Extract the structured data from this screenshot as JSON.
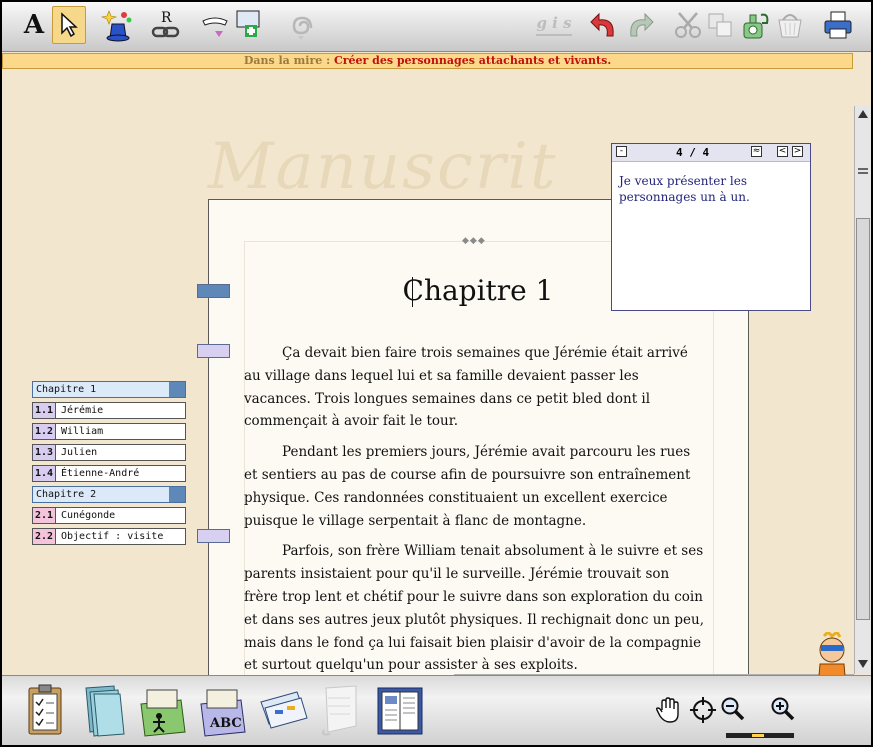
{
  "toolbar": {
    "text_tool_label": "A",
    "reference_tool_label": "R",
    "gis_label": "g i s"
  },
  "mire": {
    "label": "Dans la mire :",
    "goal": "Créer des personnages attachants et vivants."
  },
  "watermark": "Manuscrit",
  "manuscript": {
    "chapter_title": "Chapitre 1",
    "paragraphs": [
      "Ça devait bien faire trois semaines que Jérémie était arrivé au village dans lequel lui et sa famille devaient passer les vacances. Trois longues semaines dans ce petit bled dont il commençait à avoir fait le tour.",
      "Pendant les premiers jours, Jérémie avait parcouru les rues et sentiers au pas de course afin de poursuivre son entraînement physique. Ces randonnées constituaient un excellent exercice puisque le village serpentait à flanc de montagne.",
      "Parfois, son frère William tenait absolument à le suivre et ses parents insistaient pour qu'il le surveille. Jérémie trouvait son frère trop lent et chétif pour le suivre dans son exploration du coin et dans ses autres jeux plutôt physiques. Il rechignait donc un peu, mais dans le fond ça lui faisait bien plaisir d'avoir de la compagnie et surtout quelqu'un pour assister à ses exploits."
    ]
  },
  "note": {
    "minus": "-",
    "counter": "4 / 4",
    "wave": "≈",
    "prev": "<",
    "next": ">",
    "text": "Je veux présenter les personnages un à un."
  },
  "outline": {
    "chapters": [
      {
        "title": "Chapitre 1",
        "scenes": [
          {
            "num": "1.1",
            "name": "Jérémie"
          },
          {
            "num": "1.2",
            "name": "William"
          },
          {
            "num": "1.3",
            "name": "Julien"
          },
          {
            "num": "1.4",
            "name": "Étienne-André"
          }
        ]
      },
      {
        "title": "Chapitre 2",
        "scenes": [
          {
            "num": "2.1",
            "name": "Cunégonde"
          },
          {
            "num": "2.2",
            "name": "Objectif : visite"
          }
        ]
      }
    ]
  },
  "colors": {
    "ch1_scene_num": "#d8ccf0",
    "ch2_scene_num": "#f4c4dc",
    "marker_active": "#5e88b8",
    "marker": "#d8d0f0"
  },
  "bottombar": {
    "abc_label": "ABC"
  }
}
